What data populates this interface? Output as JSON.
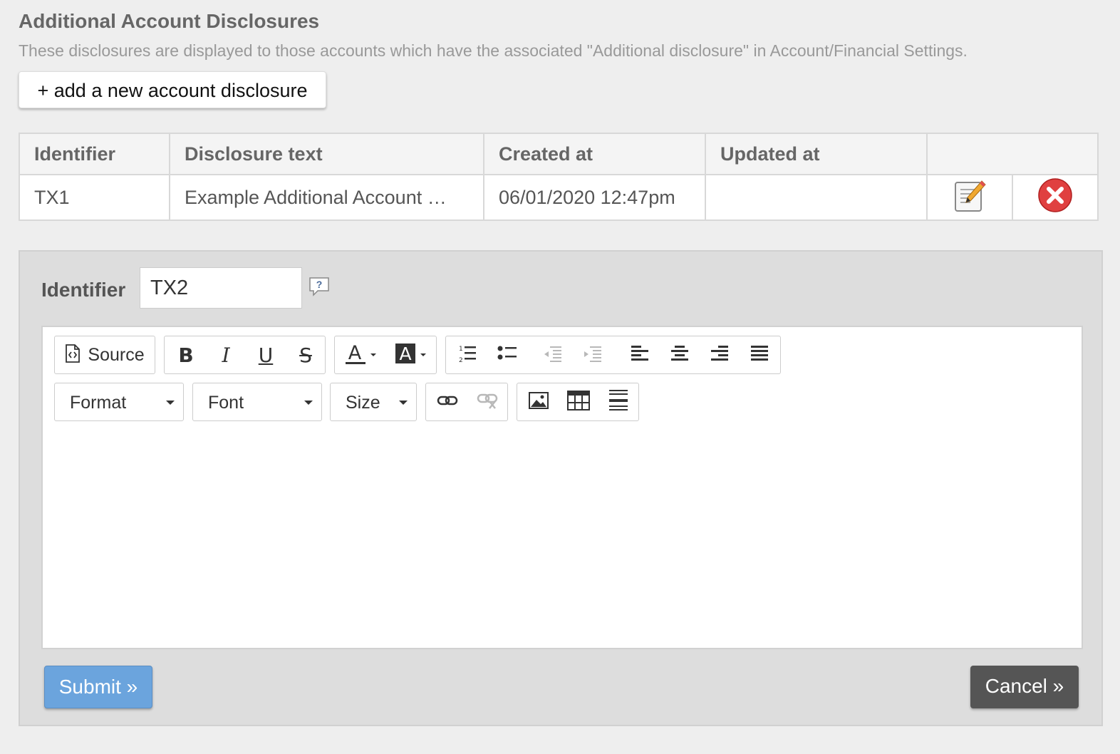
{
  "header": {
    "title": "Additional Account Disclosures",
    "subtitle": "These disclosures are displayed to those accounts which have the associated \"Additional disclosure\" in Account/Financial Settings."
  },
  "add_button_label": "+ add a new account disclosure",
  "table": {
    "columns": [
      "Identifier",
      "Disclosure text",
      "Created at",
      "Updated at",
      ""
    ],
    "rows": [
      {
        "identifier": "TX1",
        "disclosure_text": "Example Additional Account …",
        "created_at": "06/01/2020 12:47pm",
        "updated_at": "",
        "edit_icon": "edit-note-pencil-icon",
        "delete_icon": "red-circle-x-icon"
      }
    ]
  },
  "form": {
    "identifier_label": "Identifier",
    "identifier_value": "TX2",
    "help_icon": "question-bubble-icon",
    "editor": {
      "toolbar": {
        "source_label": "Source",
        "format_label": "Format",
        "font_label": "Font",
        "size_label": "Size",
        "buttons": [
          "bold",
          "italic",
          "underline",
          "strikethrough",
          "text-color",
          "background-color",
          "numbered-list",
          "bulleted-list",
          "decrease-indent",
          "increase-indent",
          "align-left",
          "align-center",
          "align-right",
          "justify",
          "link",
          "unlink",
          "image",
          "table",
          "horizontal-line"
        ]
      },
      "content": ""
    },
    "submit_label": "Submit »",
    "cancel_label": "Cancel »"
  },
  "colors": {
    "page_bg": "#eeeeee",
    "panel_bg": "#dddddd",
    "submit": "#6ba4dd",
    "cancel": "#555555",
    "delete_red": "#e04040"
  }
}
